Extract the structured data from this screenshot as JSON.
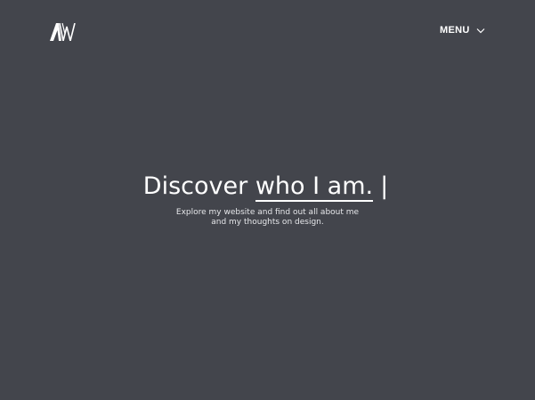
{
  "header": {
    "logo": {
      "text": "AW",
      "icon": "aw-monogram-logo"
    },
    "menu": {
      "label": "MENU",
      "icon": "chevron-down-icon"
    }
  },
  "hero": {
    "headline_prefix": "Discover",
    "headline_typed": "who I am.",
    "cursor": "|",
    "subtitle_line1": "Explore my website and find out all about me",
    "subtitle_line2": "and my thoughts on design."
  },
  "colors": {
    "background": "#43454c",
    "text": "#ffffff"
  }
}
